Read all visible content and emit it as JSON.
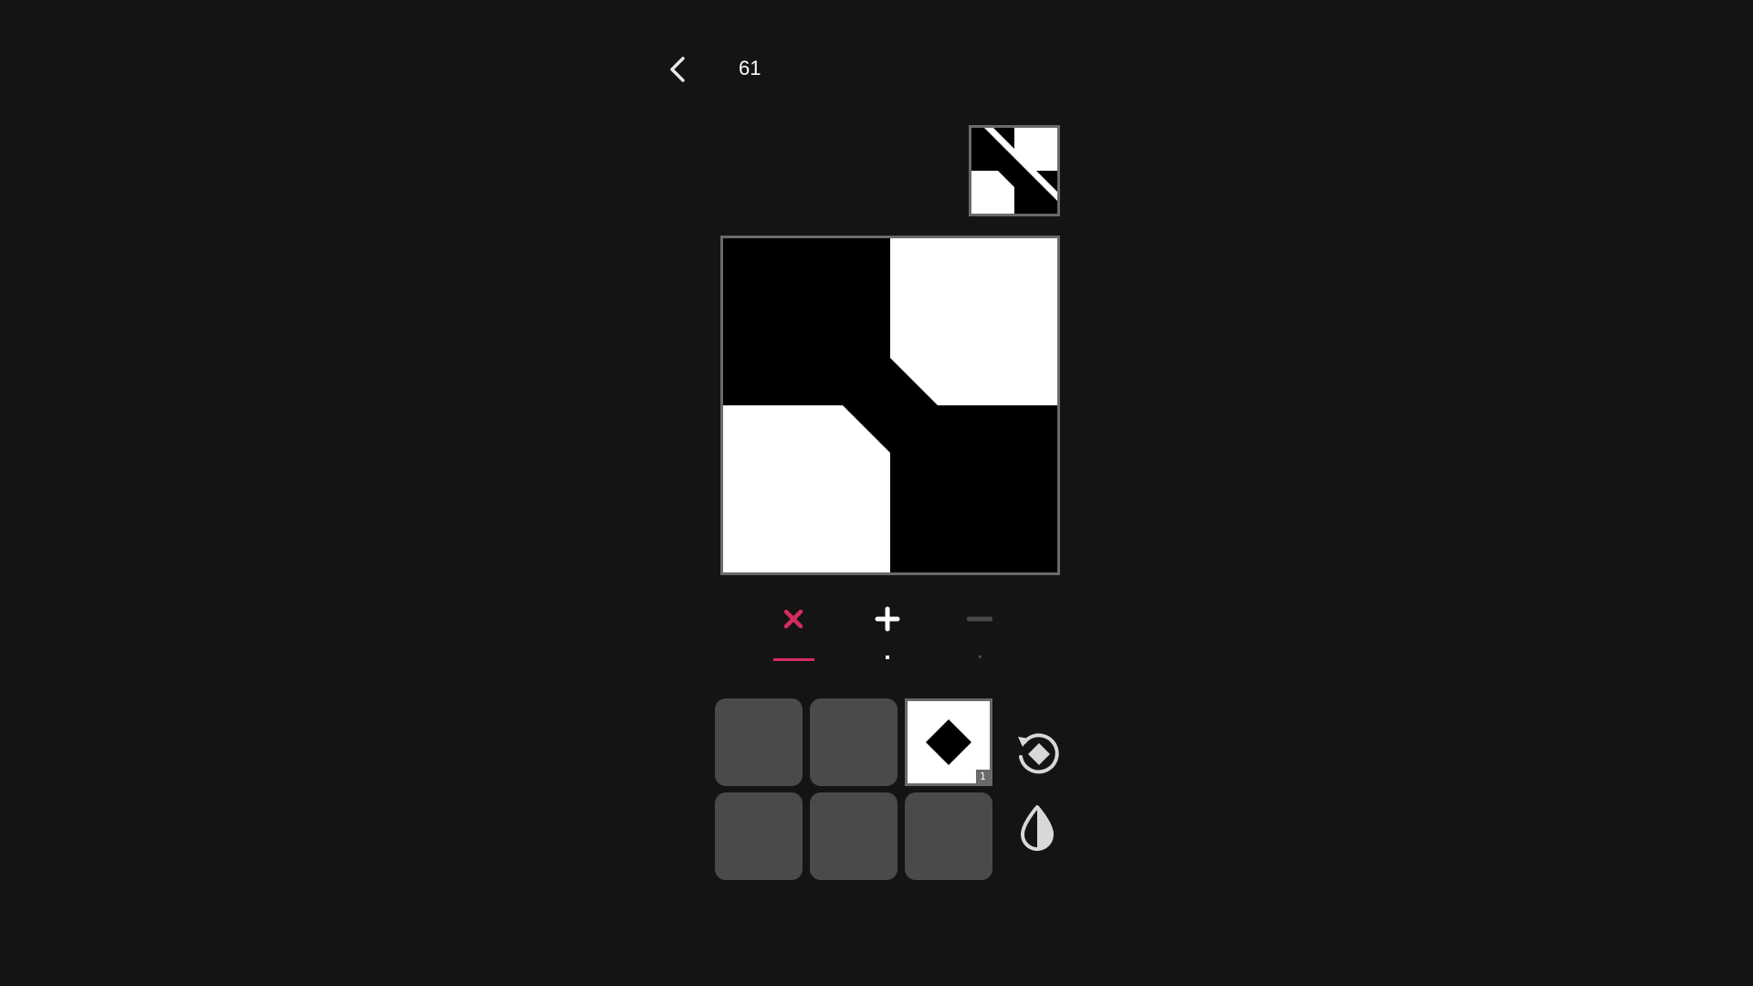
{
  "header": {
    "back_icon": "chevron-left-icon",
    "level": "61"
  },
  "target": {
    "icon": "target-pattern"
  },
  "canvas": {
    "icon": "current-pattern"
  },
  "operations": [
    {
      "name": "multiply",
      "icon": "close-icon",
      "color": "#d52c5f",
      "active": true
    },
    {
      "name": "add",
      "icon": "plus-icon",
      "color": "#ffffff",
      "active": false
    },
    {
      "name": "subtract",
      "icon": "minus-icon",
      "color": "#4a4a4a",
      "active": false
    }
  ],
  "pieces": {
    "filled_slot": {
      "icon": "diamond-icon",
      "count": "1"
    },
    "empty_slots": 5
  },
  "tools": {
    "rotate_icon": "rotate-icon",
    "invert_icon": "invert-icon"
  },
  "colors": {
    "background": "#141415",
    "accent": "#d52c5f",
    "slot": "#4a4a4b",
    "border": "#6a6a6a"
  }
}
